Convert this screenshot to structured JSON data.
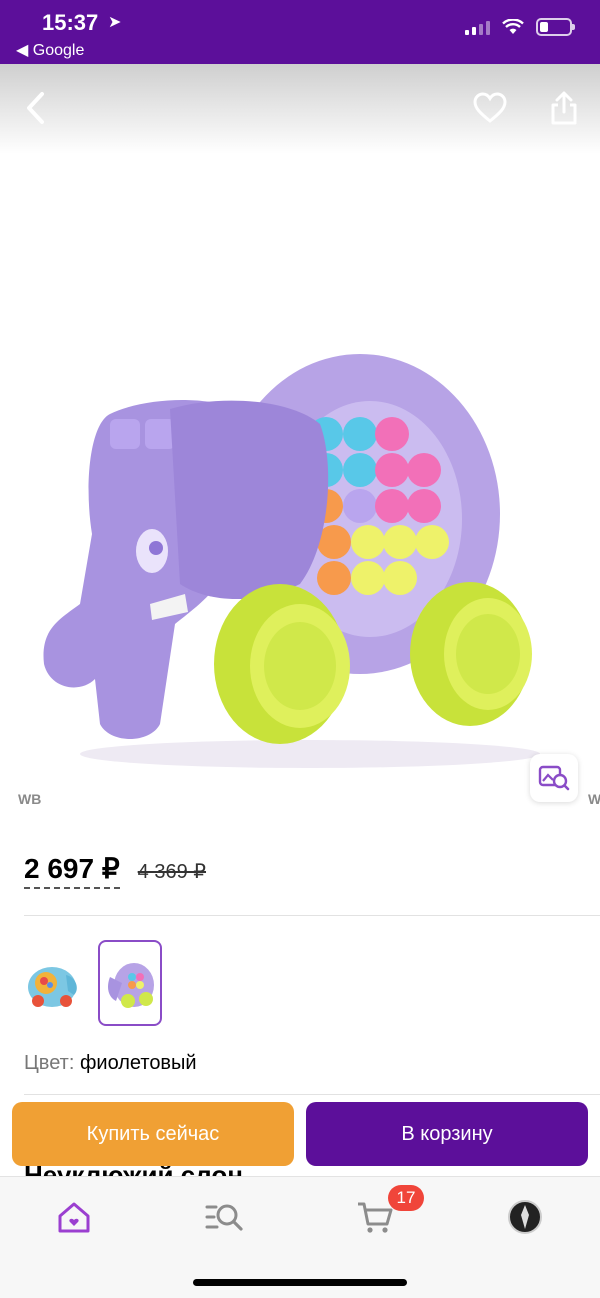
{
  "status_bar": {
    "time": "15:37",
    "back_app": "◀ Google",
    "battery_level": 0.3
  },
  "image": {
    "watermark": "WB",
    "watermark_next": "W"
  },
  "price": {
    "current": "2 697 ₽",
    "old": "4 369 ₽"
  },
  "color": {
    "label": "Цвет:",
    "value": "фиолетовый"
  },
  "actions": {
    "buy_now": "Купить сейчас",
    "add_to_cart": "В корзину"
  },
  "title_partial": "Неуклюжий слон",
  "tabbar": {
    "cart_count": "17"
  },
  "colors": {
    "brand": "#5c0f9a",
    "buy": "#f0a034",
    "badge": "#f0453a",
    "accent_icon": "#9b3fd0"
  }
}
